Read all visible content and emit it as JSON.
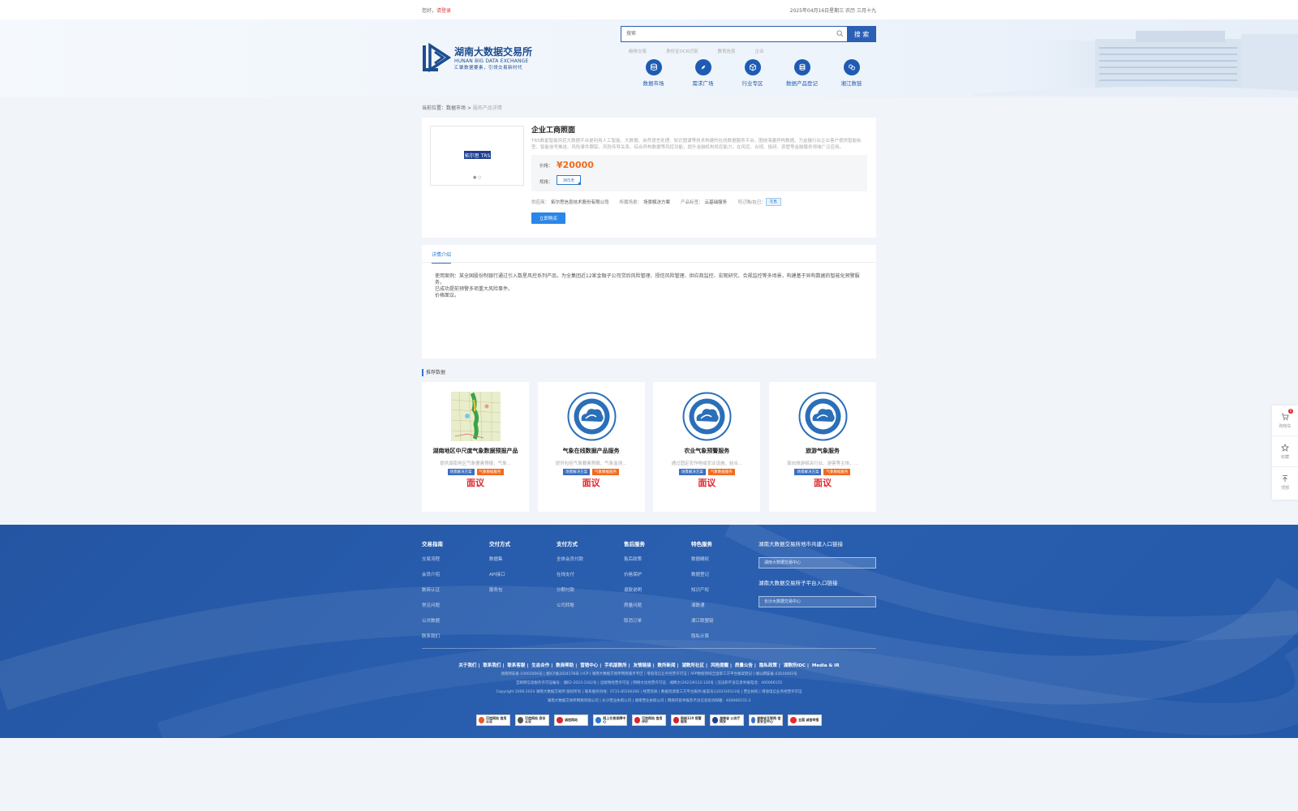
{
  "topbar": {
    "greeting": "您好，",
    "login": "请登录",
    "date": "2025年04月16日星期三 农历 三月十九"
  },
  "logo": {
    "cn": "湖南大数据交易所",
    "en": "HUNAN BIG DATA EXCHANGE",
    "slogan": "汇聚数据要素，引领交易新时代"
  },
  "search": {
    "placeholder": "搜索",
    "button": "搜 索",
    "hotwords": [
      "碳排交易",
      "身份证OCR识别",
      "教育信息",
      "企业"
    ]
  },
  "nav": [
    "数据市场",
    "需求广场",
    "行业专区",
    "数据产品登记",
    "湘江数链"
  ],
  "breadcrumb": {
    "label": "当前位置：",
    "parent": "数据市场",
    "sep": " > ",
    "current": "服务产品详情"
  },
  "product": {
    "image_text": "拓尔思 TRS",
    "title": "企业工商照面",
    "desc": "TRS数星智能风控大数据平台是利用人工智能、大数据、自然语言处理、知识图谱等技术构建的在线数据服务平台，围绕海量异构数据，为金融行业企业客户提供智能标签、智能信号推送、风险事件跟踪、风险传导关系、综合异构数据等风控功能，提升金融机构风控能力，在风控、合规、投研、资管等金融服务领域广泛应用。",
    "price_label": "价格：",
    "price": "¥20000",
    "spec_label": "规格：",
    "spec": "365天",
    "provider_label": "供应商：",
    "provider": "拓尔思信息技术股份有限公司",
    "industry_label": "所属场景：",
    "industry": "场景解决方案",
    "type_label": "产品标签：",
    "type": "云基础服务",
    "status_label": "可订购/在已：",
    "status": "在售",
    "buy_button": "立即购买"
  },
  "detail": {
    "tab": "详情介绍",
    "lines": [
      "使用案例：某全国股份制银行通过引入数星风控系列产品，为全集团近12家金融子公司贷后风险管理、授信风险管理、供应商监控、宏观研究、合规监控等多场景，构建基于异构数据的智能化预警服务，",
      "已成功提前预警多项重大风险事件。",
      "价格面议。"
    ]
  },
  "recommend": {
    "title": "推荐数据",
    "items": [
      {
        "title": "湖南地区中尺度气象数据预报产品",
        "desc": "提供湖南地区气象要素预报，气象...",
        "tag1": "场景解决方案",
        "tag2": "气象数据服务",
        "price": "面议"
      },
      {
        "title": "气象在线数据产品服务",
        "desc": "提供包括气象要素预报、气象监测...",
        "tag1": "场景解决方案",
        "tag2": "气象数据服务",
        "price": "面议"
      },
      {
        "title": "农业气象预警服务",
        "desc": "通过固定农作物或农业设施，结合...",
        "tag1": "场景解决方案",
        "tag2": "气象数据服务",
        "price": "面议"
      },
      {
        "title": "旅游气象服务",
        "desc": "面向旅游相关行业、游客等主体，...",
        "tag1": "场景解决方案",
        "tag2": "气象数据服务",
        "price": "面议"
      }
    ]
  },
  "sidefloat": {
    "cart": "购物车",
    "cart_count": "0",
    "fav": "收藏",
    "top": "顶部"
  },
  "footer": {
    "cols": [
      {
        "head": "交易指南",
        "items": [
          "交易流程",
          "会员介绍",
          "数商认证",
          "常见问题",
          "公共数据",
          "联系我们"
        ]
      },
      {
        "head": "交付方式",
        "items": [
          "数据集",
          "API接口",
          "服务包"
        ]
      },
      {
        "head": "支付方式",
        "items": [
          "全体会员付款",
          "在线支付",
          "分期付款",
          "公司转账"
        ]
      },
      {
        "head": "售后服务",
        "items": [
          "售后政策",
          "价格保护",
          "退款说明",
          "质量问题",
          "取消订单"
        ]
      },
      {
        "head": "特色服务",
        "items": [
          "数据确权",
          "数据登记",
          "知识产权",
          "湘数通",
          "湘江联盟链",
          "隐私计算"
        ]
      }
    ],
    "right_head1": "湖南大数据交易所地市共建入口链接",
    "right_sel1": "湖南大数据交易中心",
    "right_head2": "湖南大数据交易所子平台入口链接",
    "right_sel2": "长沙大数据交易中心",
    "links": [
      "关于我们",
      "联系我们",
      "联系客服",
      "生态合作",
      "数商帮助",
      "营销中心",
      "手机版数所",
      "友情链接",
      "数所新闻",
      "湖数所社区",
      "风险提醒",
      "质量公告",
      "隐私政策",
      "湖数所IDC",
      "Media & IR"
    ],
    "info": [
      "湖南网安备 10002006号  |  湘ICP备2024178号  |  ICP  |  湖南大数据交易所网络服务专区  |  增值电信业务经营许可证  |  APP数据领域全国第三方平台备案登记  |  湘公网安备 43010002号",
      "互联网信息服务许可证编号：湘B2-2023-1102号  |  出版物经营许可证  |  网络文化经营许可证：湘网文(2023)9112-120号  |  违法和不良信息举报电话：400066155",
      "Copyright 2000-2024 湖南大数据交易所 版权所有  |  联系服务热线：0731-85500266  |  经营资质  |  数据资源第三方平台服务(备案号)(2023)0513号  |  营业执照  |  增值电信业务经营许可证",
      "湖南大数据交易所网络有限公司  |  长沙营业执照公司  |  湖南营业执照公司  |  网络内容举报及不良信息投诉邮箱：400066155-3"
    ],
    "badges": [
      "可信网站 信用认证",
      "可信网站 身份认证",
      "诚信网站",
      "网上交易保障中心",
      "可信网站 信用评价",
      "网络110 报警服务",
      "湖南省 公安厅网安",
      "湖南省互联网 信息安全中心",
      "全国 诚信举报"
    ]
  }
}
